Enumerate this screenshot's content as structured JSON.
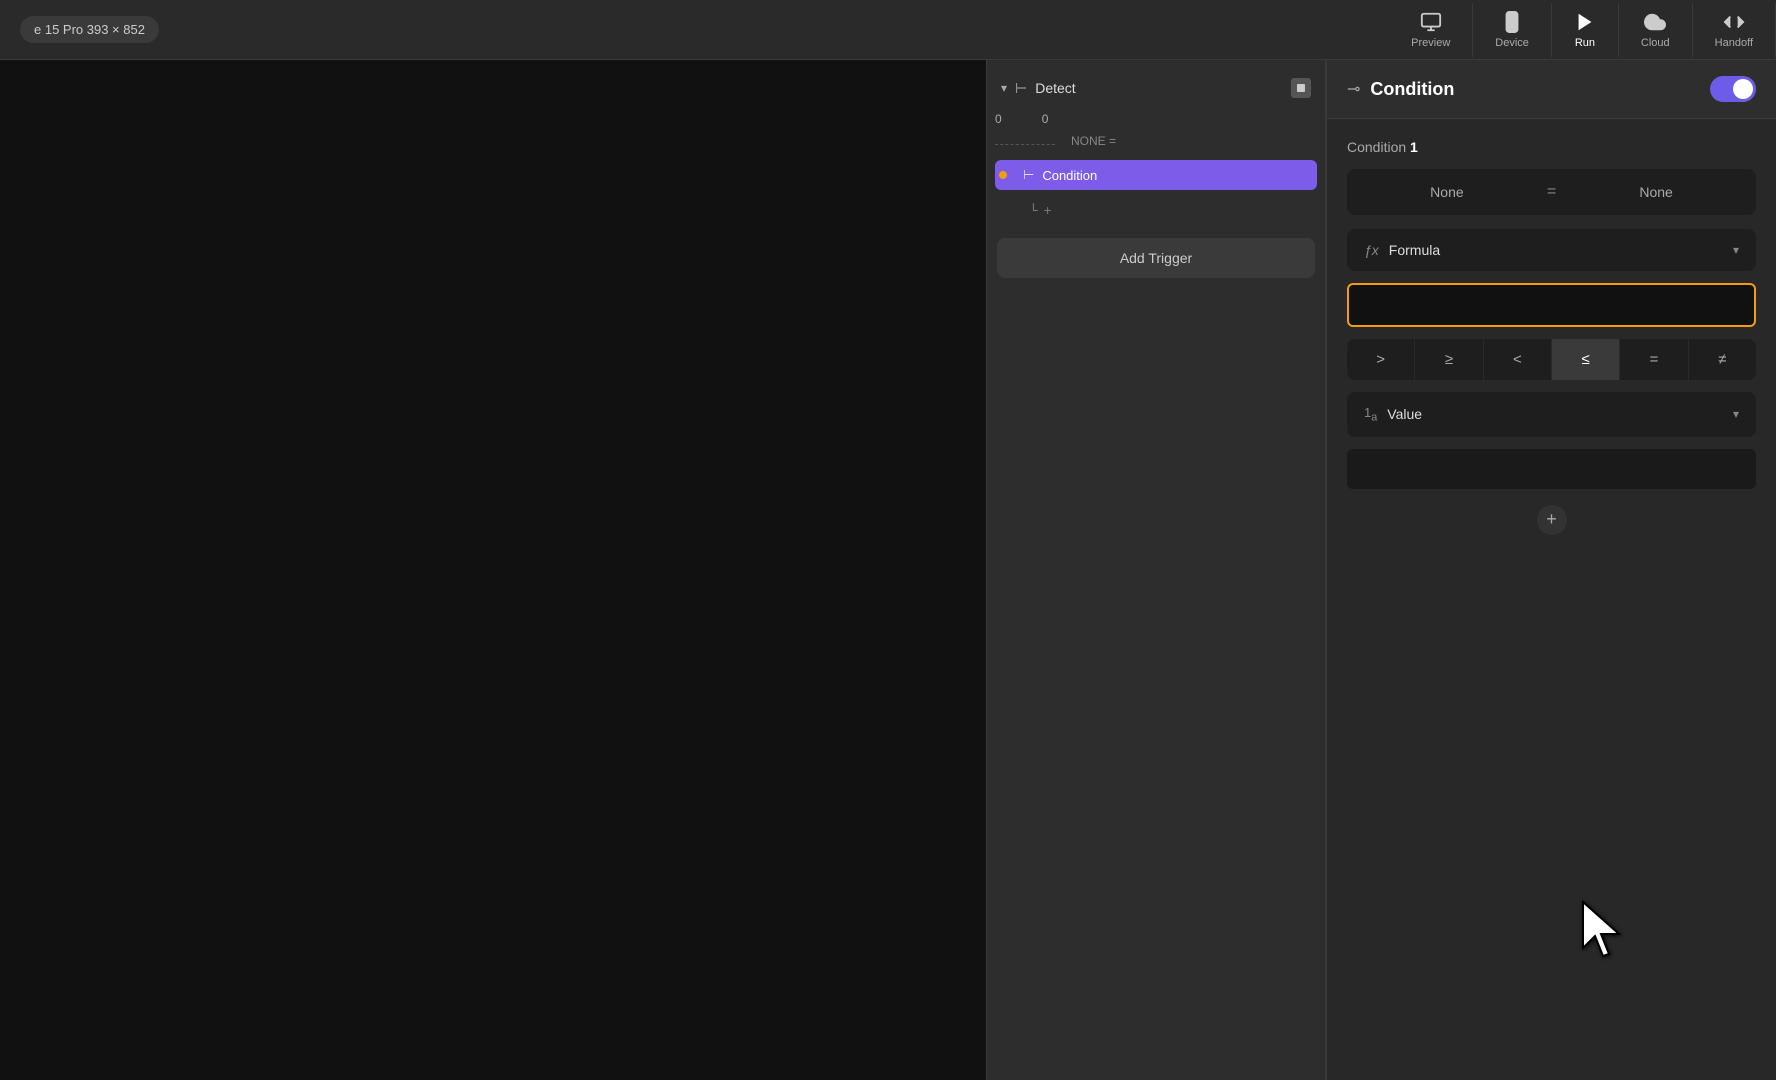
{
  "topbar": {
    "device_label": "e 15 Pro  393 × 852",
    "toolbar": [
      {
        "id": "preview",
        "label": "Preview",
        "icon": "monitor"
      },
      {
        "id": "device",
        "label": "Device",
        "icon": "phone"
      },
      {
        "id": "run",
        "label": "Run",
        "icon": "play"
      },
      {
        "id": "cloud",
        "label": "Cloud",
        "icon": "cloud"
      },
      {
        "id": "handoff",
        "label": "Handoff",
        "icon": "code"
      }
    ]
  },
  "trigger_panel": {
    "detect_label": "Detect",
    "condition_label": "Condition",
    "add_child_label": "+",
    "add_trigger_label": "Add Trigger",
    "number1": "0",
    "number2": "0",
    "none_eq": "NONE ="
  },
  "props_panel": {
    "title": "Condition",
    "condition_heading": "Condition",
    "condition_number": "1",
    "none_left": "None",
    "equals_sign": "=",
    "none_right": "None",
    "formula_label": "Formula",
    "formula_input_value": "",
    "formula_input_placeholder": "",
    "operators": [
      ">",
      "≥",
      "<",
      "≤",
      "=",
      "≠"
    ],
    "active_operator_index": 3,
    "value_label": "Value",
    "add_btn": "+"
  }
}
